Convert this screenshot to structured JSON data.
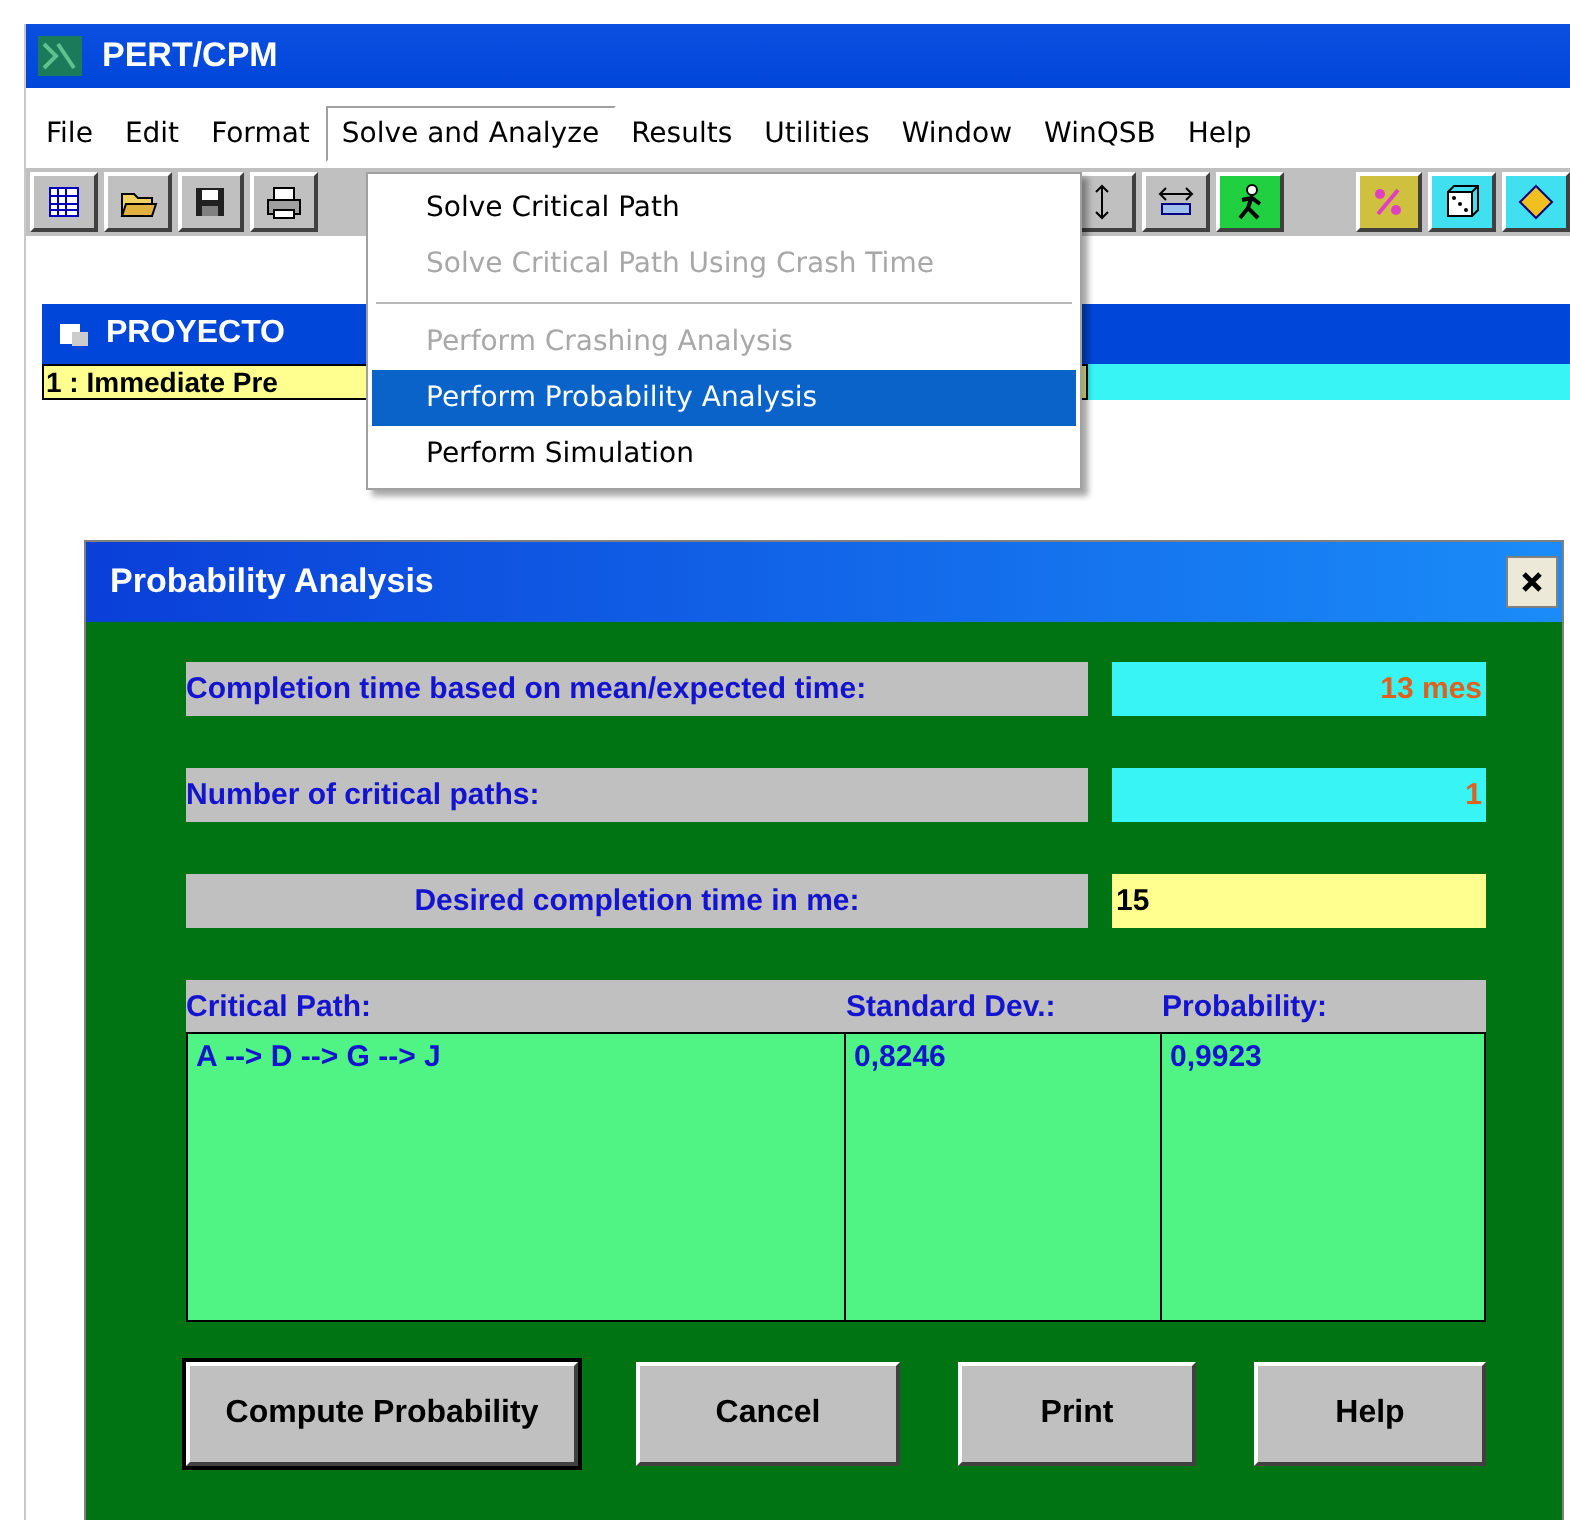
{
  "window": {
    "title": "PERT/CPM"
  },
  "menubar": [
    {
      "label": "File",
      "selected": false
    },
    {
      "label": "Edit",
      "selected": false
    },
    {
      "label": "Format",
      "selected": false
    },
    {
      "label": "Solve and Analyze",
      "selected": true
    },
    {
      "label": "Results",
      "selected": false
    },
    {
      "label": "Utilities",
      "selected": false
    },
    {
      "label": "Window",
      "selected": false
    },
    {
      "label": "WinQSB",
      "selected": false
    },
    {
      "label": "Help",
      "selected": false
    }
  ],
  "dropdown": [
    {
      "kind": "item",
      "label": "Solve Critical Path",
      "disabled": false,
      "selected": false
    },
    {
      "kind": "item",
      "label": "Solve Critical Path Using Crash Time",
      "disabled": true,
      "selected": false
    },
    {
      "kind": "separator"
    },
    {
      "kind": "item",
      "label": "Perform Crashing Analysis",
      "disabled": true,
      "selected": false
    },
    {
      "kind": "item",
      "label": "Perform Probability Analysis",
      "disabled": false,
      "selected": true
    },
    {
      "kind": "item",
      "label": "Perform Simulation",
      "disabled": false,
      "selected": false
    }
  ],
  "document": {
    "title": "PROYECTO",
    "cell": "1 : Immediate Pre"
  },
  "dialog": {
    "title": "Probability Analysis",
    "fields": [
      {
        "label": "Completion time based on mean/expected time:",
        "value": "13 mes",
        "kind": "output"
      },
      {
        "label": "Number of critical paths:",
        "value": "1",
        "kind": "output"
      },
      {
        "label": "Desired completion time in me:",
        "value": "15",
        "kind": "input"
      }
    ],
    "table": {
      "columns": [
        "Critical Path:",
        "Standard Dev.:",
        "Probability:"
      ],
      "rows": [
        [
          "A --> D --> G --> J",
          "0,8246",
          "0,9923"
        ]
      ]
    },
    "buttons": [
      {
        "label": "Compute Probability",
        "default": true
      },
      {
        "label": "Cancel",
        "default": false
      },
      {
        "label": "Print",
        "default": false
      },
      {
        "label": "Help",
        "default": false
      }
    ]
  }
}
